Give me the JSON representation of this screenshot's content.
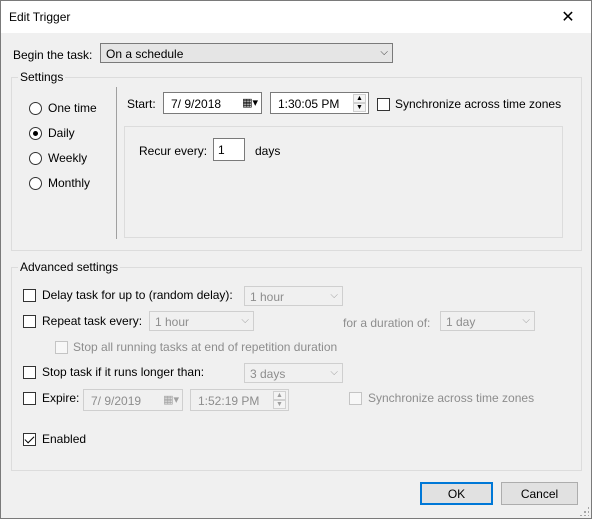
{
  "window": {
    "title": "Edit Trigger",
    "close_glyph": "✕"
  },
  "begin_task": {
    "label": "Begin the task:",
    "value": "On a schedule"
  },
  "settings": {
    "legend": "Settings",
    "schedule_options": [
      {
        "label": "One time",
        "selected": false
      },
      {
        "label": "Daily",
        "selected": true
      },
      {
        "label": "Weekly",
        "selected": false
      },
      {
        "label": "Monthly",
        "selected": false
      }
    ],
    "start_label": "Start:",
    "start_date": "7/  9/2018",
    "start_time": "1:30:05 PM",
    "sync_label": "Synchronize across time zones",
    "sync_checked": false,
    "recur_label": "Recur every:",
    "recur_value": "1",
    "recur_unit": "days"
  },
  "advanced": {
    "legend": "Advanced settings",
    "delay_label": "Delay task for up to (random delay):",
    "delay_value": "1 hour",
    "repeat_label": "Repeat task every:",
    "repeat_value": "1 hour",
    "duration_label": "for a duration of:",
    "duration_value": "1 day",
    "stop_running_label": "Stop all running tasks at end of repetition duration",
    "stop_longer_label": "Stop task if it runs longer than:",
    "stop_longer_value": "3 days",
    "expire_label": "Expire:",
    "expire_date": "7/  9/2019",
    "expire_time": "1:52:19 PM",
    "expire_sync_label": "Synchronize across time zones",
    "enabled_label": "Enabled",
    "enabled_checked": true
  },
  "buttons": {
    "ok": "OK",
    "cancel": "Cancel"
  }
}
